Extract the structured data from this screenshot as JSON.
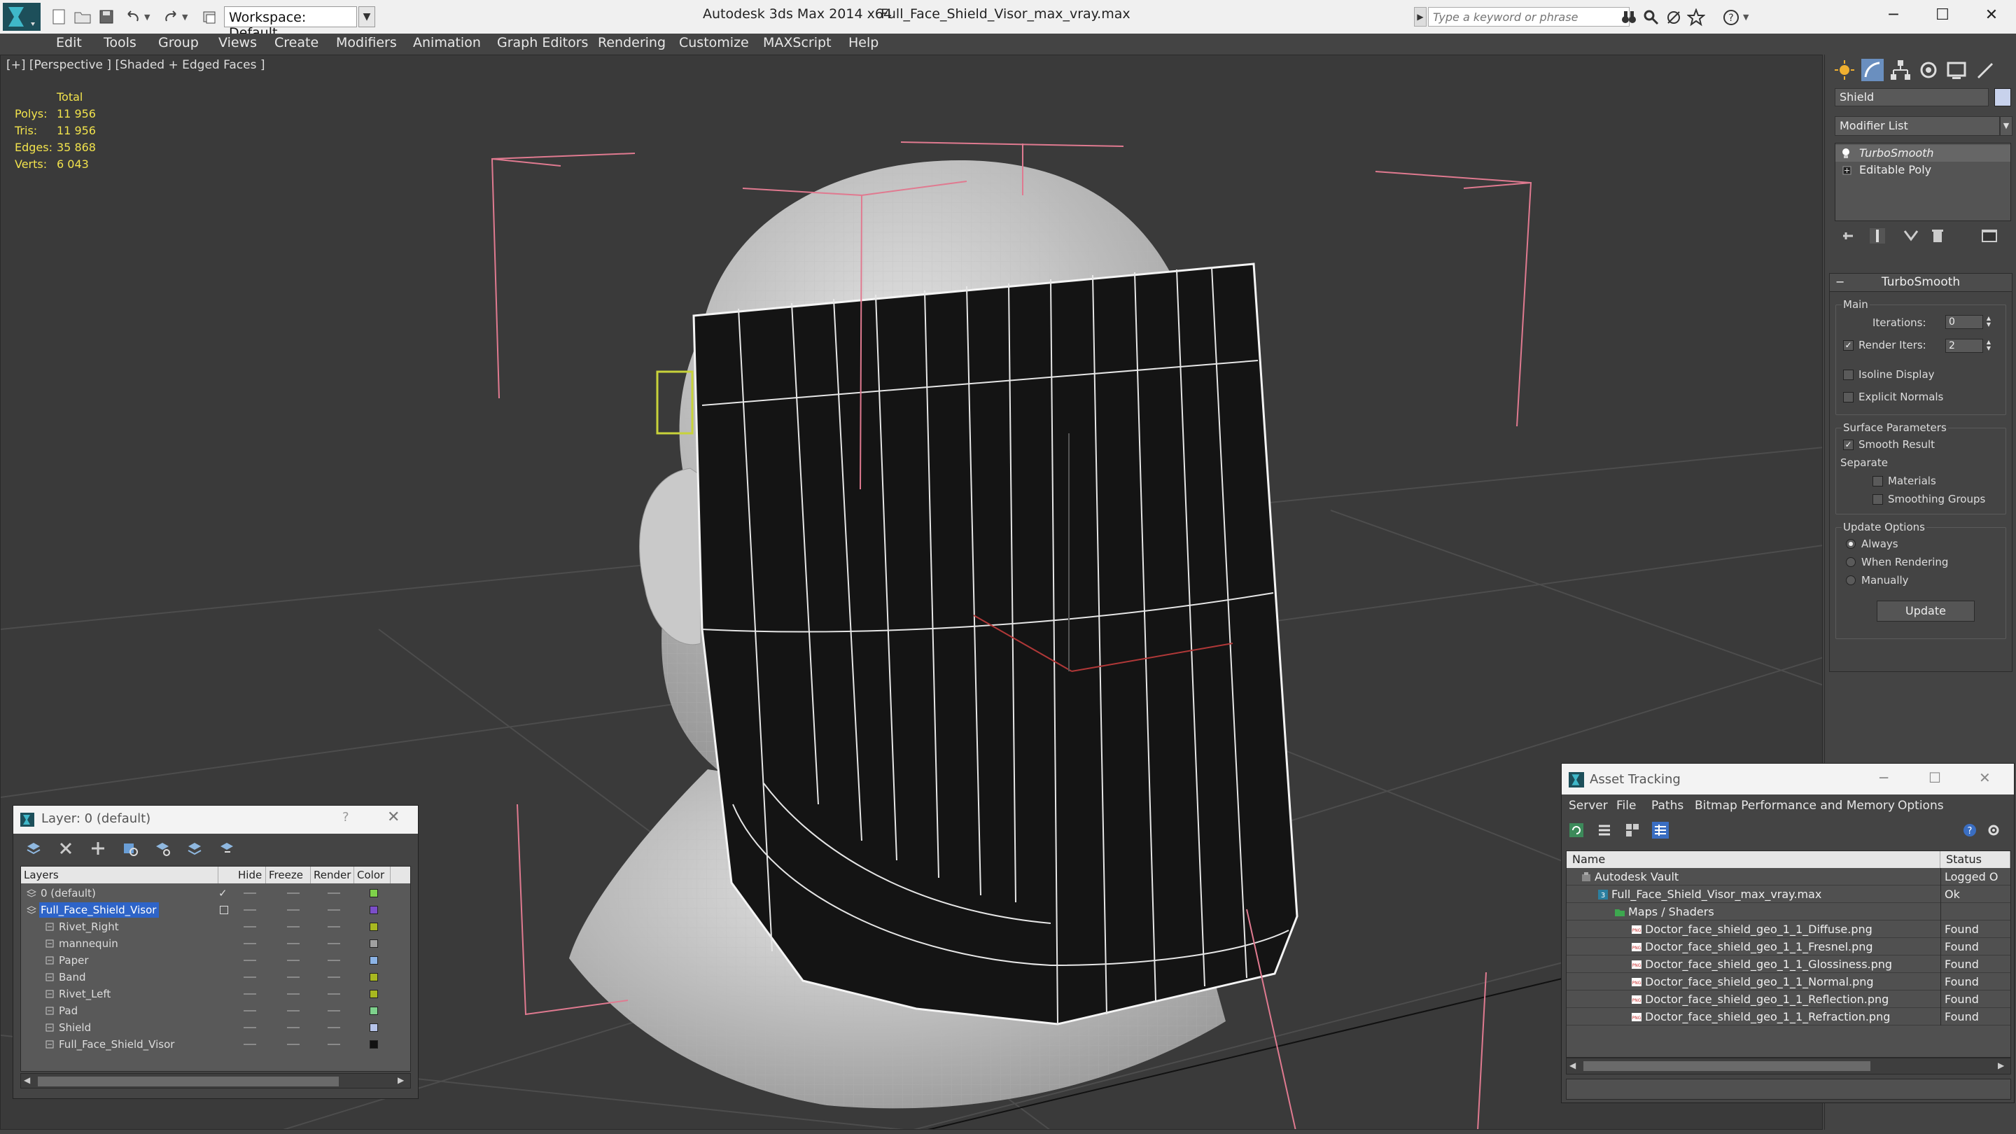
{
  "titlebar": {
    "workspace": "Workspace: Default",
    "app_title": "Autodesk 3ds Max 2014 x64",
    "file_title": "Full_Face_Shield_Visor_max_vray.max",
    "search_placeholder": "Type a keyword or phrase"
  },
  "menubar": [
    "Edit",
    "Tools",
    "Group",
    "Views",
    "Create",
    "Modifiers",
    "Animation",
    "Graph Editors",
    "Rendering",
    "Customize",
    "MAXScript",
    "Help"
  ],
  "viewport": {
    "label": "[+] [Perspective ] [Shaded + Edged Faces ]",
    "stats": {
      "header": "Total",
      "rows": [
        {
          "label": "Polys:",
          "value": "11 956"
        },
        {
          "label": "Tris:",
          "value": "11 956"
        },
        {
          "label": "Edges:",
          "value": "35 868"
        },
        {
          "label": "Verts:",
          "value": "6 043"
        }
      ]
    }
  },
  "command_panel": {
    "object_name": "Shield",
    "modifier_list": "Modifier List",
    "stack": [
      "TurboSmooth",
      "Editable Poly"
    ],
    "turbosmooth": {
      "title": "TurboSmooth",
      "main_label": "Main",
      "iterations_label": "Iterations:",
      "iterations_value": "0",
      "render_iters_label": "Render Iters:",
      "render_iters_value": "2",
      "isoline_label": "Isoline Display",
      "explicit_label": "Explicit Normals",
      "surface_label": "Surface Parameters",
      "smooth_result_label": "Smooth Result",
      "separate_label": "Separate",
      "materials_label": "Materials",
      "smoothing_groups_label": "Smoothing Groups",
      "update_options_label": "Update Options",
      "always_label": "Always",
      "when_rendering_label": "When Rendering",
      "manually_label": "Manually",
      "update_button": "Update"
    }
  },
  "layer_dialog": {
    "title": "Layer: 0 (default)",
    "help": "?",
    "columns": [
      "Layers",
      "Hide",
      "Freeze",
      "Render",
      "Color"
    ],
    "rows": [
      {
        "name": "0 (default)",
        "indent": 0,
        "color": "#7ed14a",
        "type": "layer"
      },
      {
        "name": "Full_Face_Shield_Visor",
        "indent": 0,
        "color": "#7b4ec8",
        "type": "layer",
        "selected": true
      },
      {
        "name": "Rivet_Right",
        "indent": 1,
        "color": "#a8b820",
        "type": "object"
      },
      {
        "name": "mannequin",
        "indent": 1,
        "color": "#a0a0a0",
        "type": "object"
      },
      {
        "name": "Paper",
        "indent": 1,
        "color": "#8cb4e6",
        "type": "object"
      },
      {
        "name": "Band",
        "indent": 1,
        "color": "#a8b820",
        "type": "object"
      },
      {
        "name": "Rivet_Left",
        "indent": 1,
        "color": "#a8b820",
        "type": "object"
      },
      {
        "name": "Pad",
        "indent": 1,
        "color": "#7ed18c",
        "type": "object"
      },
      {
        "name": "Shield",
        "indent": 1,
        "color": "#b6c4ea",
        "type": "object"
      },
      {
        "name": "Full_Face_Shield_Visor",
        "indent": 1,
        "color": "#111111",
        "type": "object"
      }
    ]
  },
  "asset_dialog": {
    "title": "Asset Tracking",
    "menu": [
      "Server",
      "File",
      "Paths",
      "Bitmap Performance and Memory",
      "Options"
    ],
    "columns": [
      "Name",
      "Status"
    ],
    "rows": [
      {
        "name": "Autodesk Vault",
        "status": "Logged O",
        "indent": 0,
        "type": "vault"
      },
      {
        "name": "Full_Face_Shield_Visor_max_vray.max",
        "status": "Ok",
        "indent": 1,
        "type": "max"
      },
      {
        "name": "Maps / Shaders",
        "status": "",
        "indent": 2,
        "type": "folder"
      },
      {
        "name": "Doctor_face_shield_geo_1_1_Diffuse.png",
        "status": "Found",
        "indent": 3,
        "type": "png"
      },
      {
        "name": "Doctor_face_shield_geo_1_1_Fresnel.png",
        "status": "Found",
        "indent": 3,
        "type": "png"
      },
      {
        "name": "Doctor_face_shield_geo_1_1_Glossiness.png",
        "status": "Found",
        "indent": 3,
        "type": "png"
      },
      {
        "name": "Doctor_face_shield_geo_1_1_Normal.png",
        "status": "Found",
        "indent": 3,
        "type": "png"
      },
      {
        "name": "Doctor_face_shield_geo_1_1_Reflection.png",
        "status": "Found",
        "indent": 3,
        "type": "png"
      },
      {
        "name": "Doctor_face_shield_geo_1_1_Refraction.png",
        "status": "Found",
        "indent": 3,
        "type": "png"
      }
    ]
  }
}
